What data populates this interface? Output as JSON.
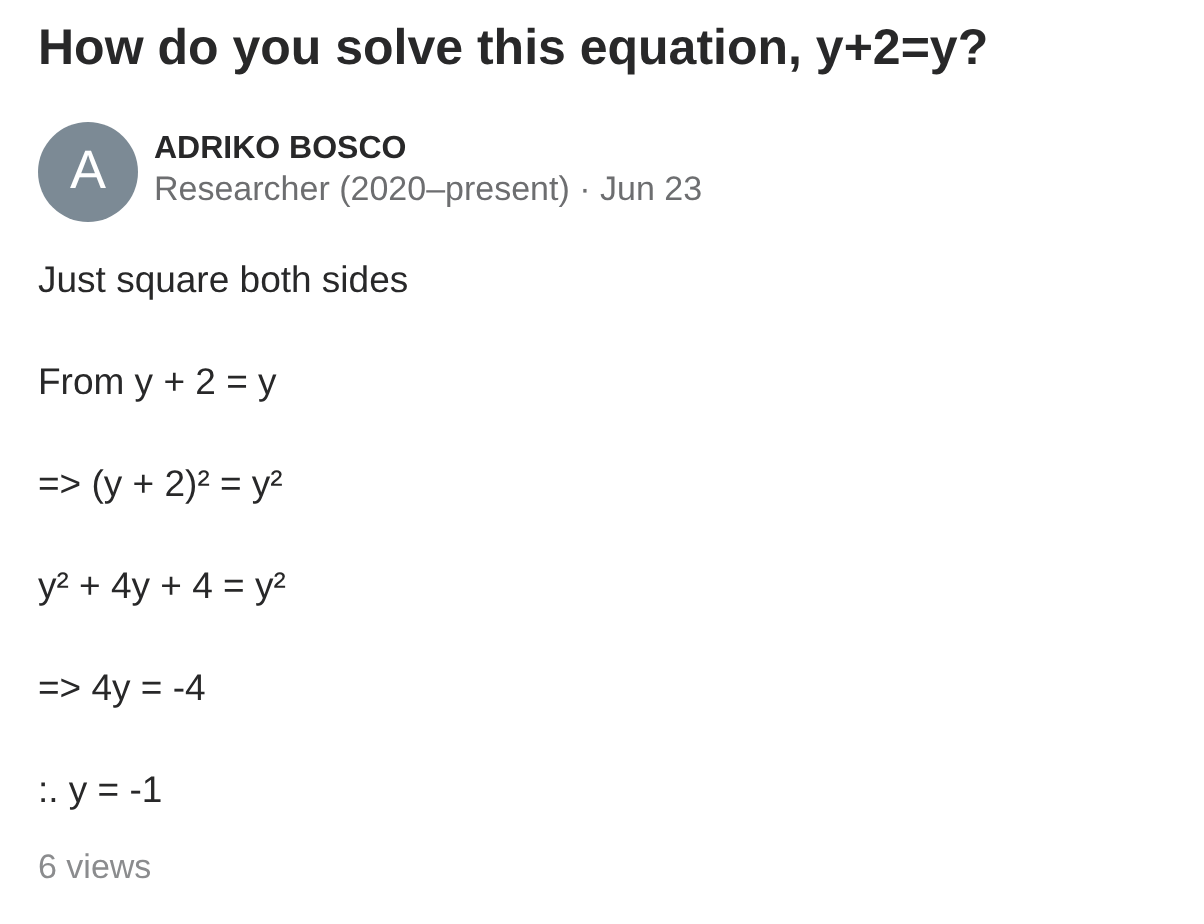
{
  "title": "How do you solve this equation, y+2=y?",
  "author": {
    "avatar_letter": "A",
    "name": "ADRIKO BOSCO",
    "credential": "Researcher (2020–present) · Jun 23"
  },
  "lines": [
    "Just square both sides",
    "From y + 2 = y",
    "=> (y + 2)² = y²",
    "y² + 4y + 4 = y²",
    "=> 4y = -4",
    ":. y = -1"
  ],
  "views": "6 views"
}
